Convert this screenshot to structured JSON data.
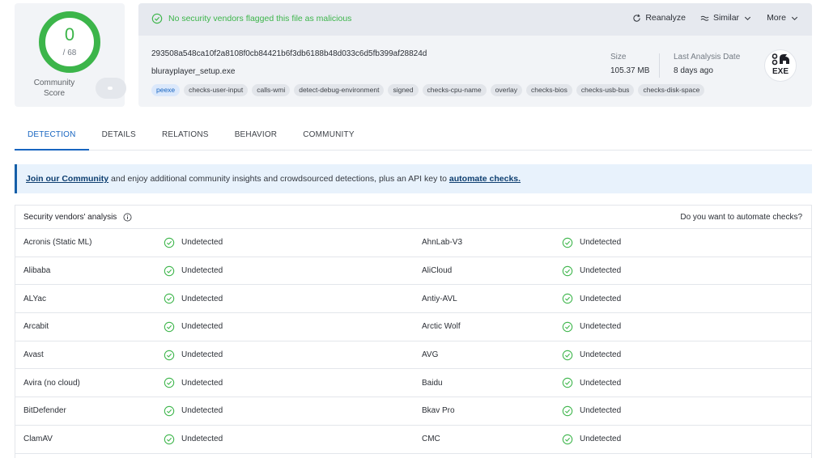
{
  "score": {
    "detections": "0",
    "total": "/ 68",
    "community_label": "Community Score"
  },
  "file": {
    "status": "No security vendors flagged this file as malicious",
    "hash": "293508a548ca10f2a8108f0cb84421b6f3db6188b48d033c6d5fb399af28824d",
    "name": "blurayplayer_setup.exe",
    "tags": [
      "peexe",
      "checks-user-input",
      "calls-wmi",
      "detect-debug-environment",
      "signed",
      "checks-cpu-name",
      "overlay",
      "checks-bios",
      "checks-usb-bus",
      "checks-disk-space"
    ],
    "size_label": "Size",
    "size_value": "105.37 MB",
    "date_label": "Last Analysis Date",
    "date_value": "8 days ago",
    "type_label": "EXE"
  },
  "actions": {
    "reanalyze": "Reanalyze",
    "similar": "Similar",
    "more": "More"
  },
  "tabs": [
    "DETECTION",
    "DETAILS",
    "RELATIONS",
    "BEHAVIOR",
    "COMMUNITY"
  ],
  "banner": {
    "link1": "Join our Community",
    "middle": " and enjoy additional community insights and crowdsourced detections, plus an API key to ",
    "link2": "automate checks."
  },
  "vendors": {
    "title": "Security vendors' analysis",
    "automate": "Do you want to automate checks?",
    "rows": [
      {
        "left": "Acronis (Static ML)",
        "left_result": "Undetected",
        "right": "AhnLab-V3",
        "right_result": "Undetected"
      },
      {
        "left": "Alibaba",
        "left_result": "Undetected",
        "right": "AliCloud",
        "right_result": "Undetected"
      },
      {
        "left": "ALYac",
        "left_result": "Undetected",
        "right": "Antiy-AVL",
        "right_result": "Undetected"
      },
      {
        "left": "Arcabit",
        "left_result": "Undetected",
        "right": "Arctic Wolf",
        "right_result": "Undetected"
      },
      {
        "left": "Avast",
        "left_result": "Undetected",
        "right": "AVG",
        "right_result": "Undetected"
      },
      {
        "left": "Avira (no cloud)",
        "left_result": "Undetected",
        "right": "Baidu",
        "right_result": "Undetected"
      },
      {
        "left": "BitDefender",
        "left_result": "Undetected",
        "right": "Bkav Pro",
        "right_result": "Undetected"
      },
      {
        "left": "ClamAV",
        "left_result": "Undetected",
        "right": "CMC",
        "right_result": "Undetected"
      }
    ]
  },
  "colors": {
    "clean": "#3cb54a",
    "accent": "#1765c0"
  }
}
